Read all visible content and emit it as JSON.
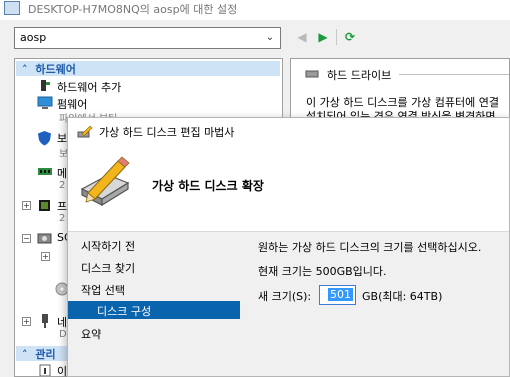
{
  "window": {
    "title": "DESKTOP-H7MO8NQ의 aosp에 대한 설정"
  },
  "toolbar": {
    "vm_name": "aosp"
  },
  "hardware_tree": {
    "section_label": "하드웨어",
    "items": [
      {
        "label": "하드웨어 추가",
        "icon": "add-hardware-icon"
      },
      {
        "label": "펌웨어",
        "icon": "firmware-icon",
        "sub": "파일에서 부팅"
      },
      {
        "label": "보",
        "icon": "security-shield-icon",
        "sub": "보"
      },
      {
        "label": "메",
        "icon": "memory-icon",
        "sub": "2"
      },
      {
        "label": "프",
        "icon": "processor-icon",
        "sub": "2"
      },
      {
        "label": "SC",
        "icon": "scsi-controller-icon"
      },
      {
        "label": "네",
        "icon": "network-adapter-icon",
        "sub": "D"
      }
    ],
    "management_label": "관리",
    "management_items": [
      {
        "label": "이",
        "icon": "info-icon"
      }
    ]
  },
  "right_panel": {
    "section_title": "하드 드라이브",
    "line1": "이 가상 하드 디스크를 가상 컴퓨터에 연결",
    "line2": "설치되어 있는 경우 연결 방식을 변경하면"
  },
  "wizard": {
    "title": "가상 하드 디스크 편집 마법사",
    "heading": "가상 하드 디스크 확장",
    "steps": [
      "시작하기 전",
      "디스크 찾기",
      "작업 선택",
      "디스크 구성",
      "요약"
    ],
    "active_step": "디스크 구성",
    "instruction": "원하는 가상 하드 디스크의 크기를 선택하십시오.",
    "current_size": "현재 크기는 500GB입니다.",
    "new_size_label": "새 크기(S):",
    "new_size_value": "501",
    "size_unit": "GB(최대: 64TB)"
  },
  "colors": {
    "accent": "#0a64ad",
    "section_bg": "#cfe3f7",
    "section_text": "#1d5aa8",
    "play_green": "#1c9a3a"
  }
}
